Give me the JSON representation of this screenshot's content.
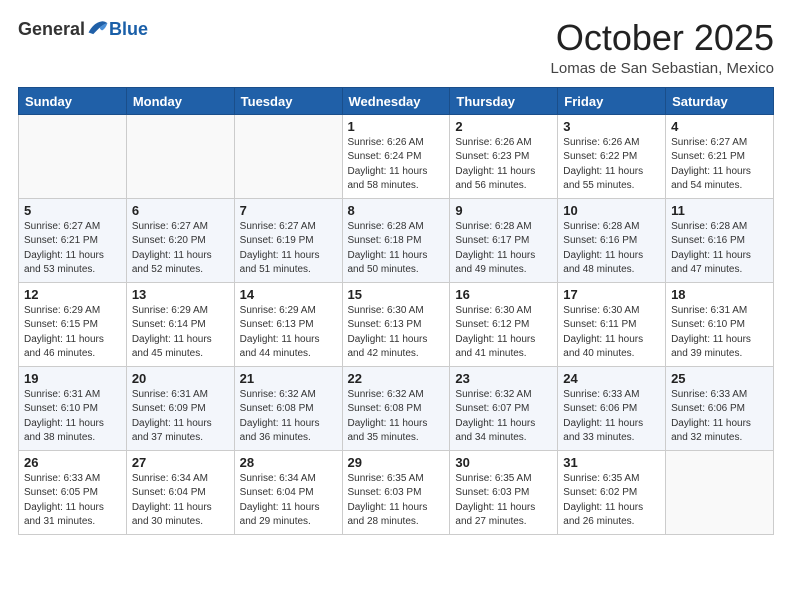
{
  "header": {
    "logo": {
      "general": "General",
      "blue": "Blue"
    },
    "title": "October 2025",
    "location": "Lomas de San Sebastian, Mexico"
  },
  "weekdays": [
    "Sunday",
    "Monday",
    "Tuesday",
    "Wednesday",
    "Thursday",
    "Friday",
    "Saturday"
  ],
  "weeks": [
    [
      {
        "day": "",
        "sunrise": "",
        "sunset": "",
        "daylight": ""
      },
      {
        "day": "",
        "sunrise": "",
        "sunset": "",
        "daylight": ""
      },
      {
        "day": "",
        "sunrise": "",
        "sunset": "",
        "daylight": ""
      },
      {
        "day": "1",
        "sunrise": "Sunrise: 6:26 AM",
        "sunset": "Sunset: 6:24 PM",
        "daylight": "Daylight: 11 hours and 58 minutes."
      },
      {
        "day": "2",
        "sunrise": "Sunrise: 6:26 AM",
        "sunset": "Sunset: 6:23 PM",
        "daylight": "Daylight: 11 hours and 56 minutes."
      },
      {
        "day": "3",
        "sunrise": "Sunrise: 6:26 AM",
        "sunset": "Sunset: 6:22 PM",
        "daylight": "Daylight: 11 hours and 55 minutes."
      },
      {
        "day": "4",
        "sunrise": "Sunrise: 6:27 AM",
        "sunset": "Sunset: 6:21 PM",
        "daylight": "Daylight: 11 hours and 54 minutes."
      }
    ],
    [
      {
        "day": "5",
        "sunrise": "Sunrise: 6:27 AM",
        "sunset": "Sunset: 6:21 PM",
        "daylight": "Daylight: 11 hours and 53 minutes."
      },
      {
        "day": "6",
        "sunrise": "Sunrise: 6:27 AM",
        "sunset": "Sunset: 6:20 PM",
        "daylight": "Daylight: 11 hours and 52 minutes."
      },
      {
        "day": "7",
        "sunrise": "Sunrise: 6:27 AM",
        "sunset": "Sunset: 6:19 PM",
        "daylight": "Daylight: 11 hours and 51 minutes."
      },
      {
        "day": "8",
        "sunrise": "Sunrise: 6:28 AM",
        "sunset": "Sunset: 6:18 PM",
        "daylight": "Daylight: 11 hours and 50 minutes."
      },
      {
        "day": "9",
        "sunrise": "Sunrise: 6:28 AM",
        "sunset": "Sunset: 6:17 PM",
        "daylight": "Daylight: 11 hours and 49 minutes."
      },
      {
        "day": "10",
        "sunrise": "Sunrise: 6:28 AM",
        "sunset": "Sunset: 6:16 PM",
        "daylight": "Daylight: 11 hours and 48 minutes."
      },
      {
        "day": "11",
        "sunrise": "Sunrise: 6:28 AM",
        "sunset": "Sunset: 6:16 PM",
        "daylight": "Daylight: 11 hours and 47 minutes."
      }
    ],
    [
      {
        "day": "12",
        "sunrise": "Sunrise: 6:29 AM",
        "sunset": "Sunset: 6:15 PM",
        "daylight": "Daylight: 11 hours and 46 minutes."
      },
      {
        "day": "13",
        "sunrise": "Sunrise: 6:29 AM",
        "sunset": "Sunset: 6:14 PM",
        "daylight": "Daylight: 11 hours and 45 minutes."
      },
      {
        "day": "14",
        "sunrise": "Sunrise: 6:29 AM",
        "sunset": "Sunset: 6:13 PM",
        "daylight": "Daylight: 11 hours and 44 minutes."
      },
      {
        "day": "15",
        "sunrise": "Sunrise: 6:30 AM",
        "sunset": "Sunset: 6:13 PM",
        "daylight": "Daylight: 11 hours and 42 minutes."
      },
      {
        "day": "16",
        "sunrise": "Sunrise: 6:30 AM",
        "sunset": "Sunset: 6:12 PM",
        "daylight": "Daylight: 11 hours and 41 minutes."
      },
      {
        "day": "17",
        "sunrise": "Sunrise: 6:30 AM",
        "sunset": "Sunset: 6:11 PM",
        "daylight": "Daylight: 11 hours and 40 minutes."
      },
      {
        "day": "18",
        "sunrise": "Sunrise: 6:31 AM",
        "sunset": "Sunset: 6:10 PM",
        "daylight": "Daylight: 11 hours and 39 minutes."
      }
    ],
    [
      {
        "day": "19",
        "sunrise": "Sunrise: 6:31 AM",
        "sunset": "Sunset: 6:10 PM",
        "daylight": "Daylight: 11 hours and 38 minutes."
      },
      {
        "day": "20",
        "sunrise": "Sunrise: 6:31 AM",
        "sunset": "Sunset: 6:09 PM",
        "daylight": "Daylight: 11 hours and 37 minutes."
      },
      {
        "day": "21",
        "sunrise": "Sunrise: 6:32 AM",
        "sunset": "Sunset: 6:08 PM",
        "daylight": "Daylight: 11 hours and 36 minutes."
      },
      {
        "day": "22",
        "sunrise": "Sunrise: 6:32 AM",
        "sunset": "Sunset: 6:08 PM",
        "daylight": "Daylight: 11 hours and 35 minutes."
      },
      {
        "day": "23",
        "sunrise": "Sunrise: 6:32 AM",
        "sunset": "Sunset: 6:07 PM",
        "daylight": "Daylight: 11 hours and 34 minutes."
      },
      {
        "day": "24",
        "sunrise": "Sunrise: 6:33 AM",
        "sunset": "Sunset: 6:06 PM",
        "daylight": "Daylight: 11 hours and 33 minutes."
      },
      {
        "day": "25",
        "sunrise": "Sunrise: 6:33 AM",
        "sunset": "Sunset: 6:06 PM",
        "daylight": "Daylight: 11 hours and 32 minutes."
      }
    ],
    [
      {
        "day": "26",
        "sunrise": "Sunrise: 6:33 AM",
        "sunset": "Sunset: 6:05 PM",
        "daylight": "Daylight: 11 hours and 31 minutes."
      },
      {
        "day": "27",
        "sunrise": "Sunrise: 6:34 AM",
        "sunset": "Sunset: 6:04 PM",
        "daylight": "Daylight: 11 hours and 30 minutes."
      },
      {
        "day": "28",
        "sunrise": "Sunrise: 6:34 AM",
        "sunset": "Sunset: 6:04 PM",
        "daylight": "Daylight: 11 hours and 29 minutes."
      },
      {
        "day": "29",
        "sunrise": "Sunrise: 6:35 AM",
        "sunset": "Sunset: 6:03 PM",
        "daylight": "Daylight: 11 hours and 28 minutes."
      },
      {
        "day": "30",
        "sunrise": "Sunrise: 6:35 AM",
        "sunset": "Sunset: 6:03 PM",
        "daylight": "Daylight: 11 hours and 27 minutes."
      },
      {
        "day": "31",
        "sunrise": "Sunrise: 6:35 AM",
        "sunset": "Sunset: 6:02 PM",
        "daylight": "Daylight: 11 hours and 26 minutes."
      },
      {
        "day": "",
        "sunrise": "",
        "sunset": "",
        "daylight": ""
      }
    ]
  ]
}
